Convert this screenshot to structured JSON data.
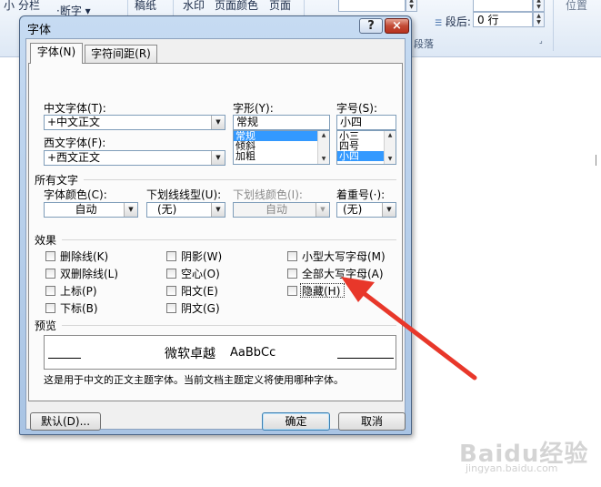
{
  "ribbon": {
    "items": [
      "小",
      "分栏",
      "断字",
      "稿纸",
      "水印",
      "页面颜色",
      "页面",
      "段后:",
      "0 行",
      "位置"
    ],
    "group_label": "段落"
  },
  "dialog": {
    "title": "字体",
    "help": "?",
    "close": "×",
    "tabs": [
      "字体(N)",
      "字符间距(R)"
    ],
    "chinese_font": {
      "label": "中文字体(T):",
      "value": "+中文正文"
    },
    "western_font": {
      "label": "西文字体(F):",
      "value": "+西文正文"
    },
    "style": {
      "label": "字形(Y):",
      "value": "常规",
      "options": [
        "常规",
        "倾斜",
        "加粗"
      ],
      "selected": "常规"
    },
    "size": {
      "label": "字号(S):",
      "value": "小四",
      "options": [
        "小三",
        "四号",
        "小四"
      ],
      "selected": "小四"
    },
    "all_text": {
      "section": "所有文字",
      "font_color": {
        "label": "字体颜色(C):",
        "value": "自动"
      },
      "underline_style": {
        "label": "下划线线型(U):",
        "value": "(无)"
      },
      "underline_color": {
        "label": "下划线颜色(I):",
        "value": "自动"
      },
      "emphasis": {
        "label": "着重号(·):",
        "value": "(无)"
      }
    },
    "effects": {
      "section": "效果",
      "items": [
        "删除线(K)",
        "双删除线(L)",
        "上标(P)",
        "下标(B)",
        "阴影(W)",
        "空心(O)",
        "阳文(E)",
        "阴文(G)",
        "小型大写字母(M)",
        "全部大写字母(A)",
        "隐藏(H)"
      ]
    },
    "preview": {
      "section": "预览",
      "sample_cn": "微软卓越",
      "sample_en": "AaBbCc",
      "note": "这是用于中文的正文主题字体。当前文档主题定义将使用哪种字体。"
    },
    "buttons": {
      "default": "默认(D)...",
      "ok": "确定",
      "cancel": "取消"
    }
  },
  "watermark": {
    "brand": "Baidu经验",
    "url": "jingyan.baidu.com"
  },
  "colors": {
    "highlight": "#3399ff",
    "arrow": "#e8372a",
    "close": "#c24a35"
  }
}
